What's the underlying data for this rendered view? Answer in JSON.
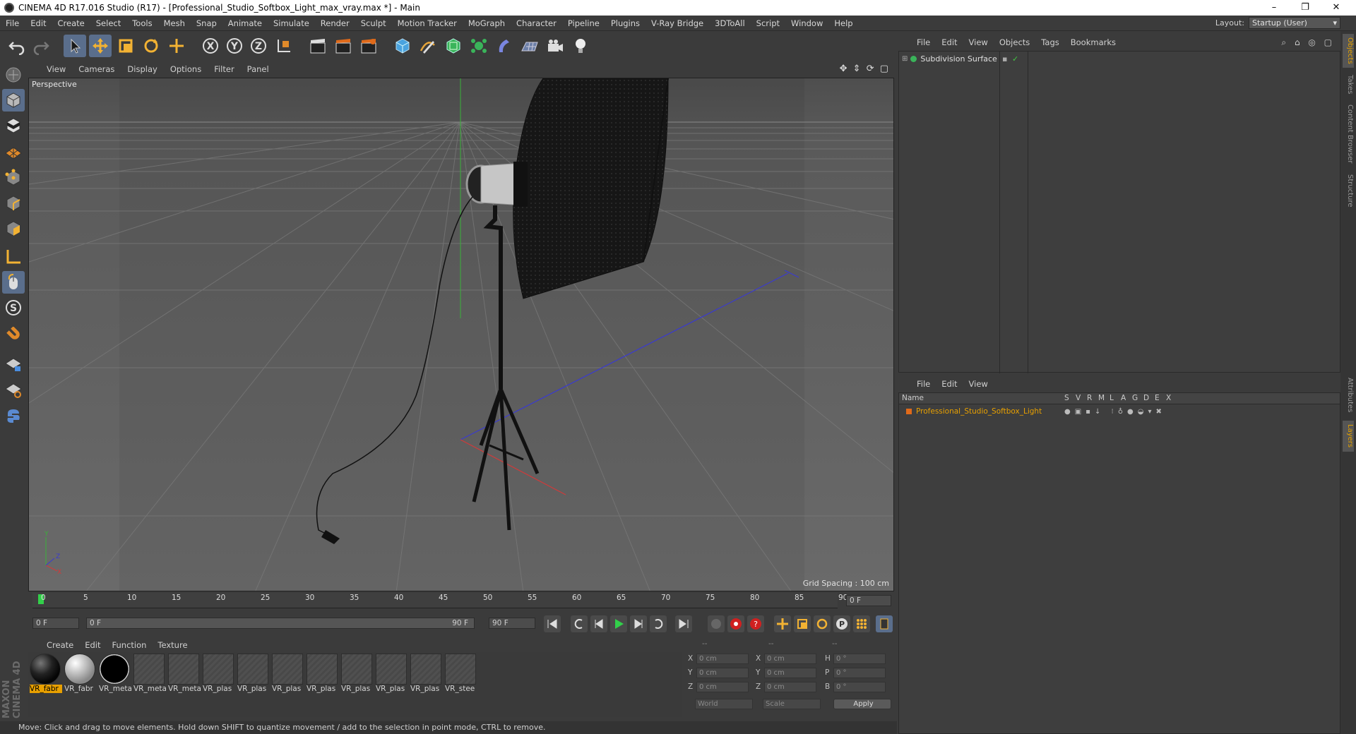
{
  "window": {
    "title": "CINEMA 4D R17.016 Studio (R17) - [Professional_Studio_Softbox_Light_max_vray.max *] - Main",
    "minimize": "–",
    "maximize": "❐",
    "close": "✕"
  },
  "menu": [
    "File",
    "Edit",
    "Create",
    "Select",
    "Tools",
    "Mesh",
    "Snap",
    "Animate",
    "Simulate",
    "Render",
    "Sculpt",
    "Motion Tracker",
    "MoGraph",
    "Character",
    "Pipeline",
    "Plugins",
    "V-Ray Bridge",
    "3DToAll",
    "Script",
    "Window",
    "Help"
  ],
  "layout": {
    "label": "Layout:",
    "value": "Startup (User)"
  },
  "viewport": {
    "menu": [
      "View",
      "Cameras",
      "Display",
      "Options",
      "Filter",
      "Panel"
    ],
    "camera_label": "Perspective",
    "grid_spacing": "Grid Spacing : 100 cm"
  },
  "timeline": {
    "ticks": [
      "0",
      "5",
      "10",
      "15",
      "20",
      "25",
      "30",
      "35",
      "40",
      "45",
      "50",
      "55",
      "60",
      "65",
      "70",
      "75",
      "80",
      "85",
      "90"
    ],
    "current_frame": "0 F",
    "start_field": "0 F",
    "range_start": "0 F",
    "range_end": "90 F",
    "end_field": "90 F"
  },
  "material_manager": {
    "menu": [
      "Create",
      "Edit",
      "Function",
      "Texture"
    ],
    "materials": [
      "VR_fabr",
      "VR_fabr",
      "VR_meta",
      "VR_meta",
      "VR_meta",
      "VR_plas",
      "VR_plas",
      "VR_plas",
      "VR_plas",
      "VR_plas",
      "VR_plas",
      "VR_plas",
      "VR_stee"
    ]
  },
  "coordinates": {
    "headers": [
      "--",
      "--",
      "--"
    ],
    "rows": [
      {
        "a": "X",
        "av": "0 cm",
        "b": "X",
        "bv": "0 cm",
        "c": "H",
        "cv": "0 °"
      },
      {
        "a": "Y",
        "av": "0 cm",
        "b": "Y",
        "bv": "0 cm",
        "c": "P",
        "cv": "0 °"
      },
      {
        "a": "Z",
        "av": "0 cm",
        "b": "Z",
        "bv": "0 cm",
        "c": "B",
        "cv": "0 °"
      }
    ],
    "mode1": "World",
    "mode2": "Scale",
    "apply": "Apply"
  },
  "object_manager": {
    "menu": [
      "File",
      "Edit",
      "View",
      "Objects",
      "Tags",
      "Bookmarks"
    ],
    "objects": [
      {
        "name": "Subdivision Surface"
      }
    ]
  },
  "layer_manager": {
    "menu": [
      "File",
      "Edit",
      "View"
    ],
    "columns": [
      "Name",
      "S",
      "V",
      "R",
      "M",
      "L",
      "A",
      "G",
      "D",
      "E",
      "X"
    ],
    "layers": [
      {
        "name": "Professional_Studio_Softbox_Light",
        "color": "#e06a1a"
      }
    ]
  },
  "side_tabs": [
    "Objects",
    "Takes",
    "Content Browser",
    "Structure",
    "Attributes",
    "Layers"
  ],
  "status": "Move: Click and drag to move elements. Hold down SHIFT to quantize movement / add to the selection in point mode, CTRL to remove.",
  "brand": "MAXON CINEMA 4D",
  "colors": {
    "accent": "#e8a000",
    "active_tool": "#5a6e8c",
    "layer_orange": "#e06a1a"
  }
}
